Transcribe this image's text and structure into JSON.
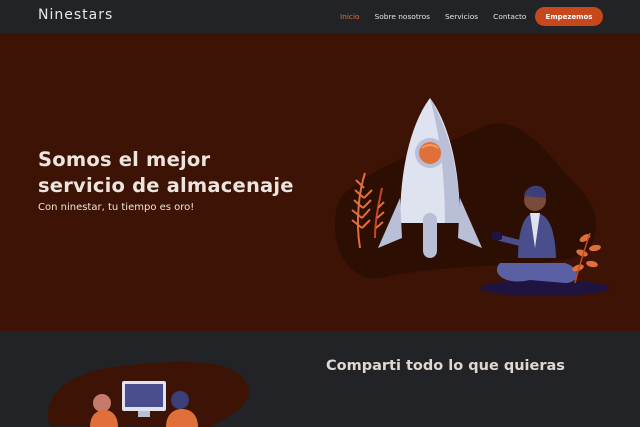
{
  "brand": "Ninestars",
  "nav": {
    "links": [
      "Inicio",
      "Sobre nosotros",
      "Servicios",
      "Contacto"
    ],
    "active_index": 0,
    "cta_label": "Empezemos"
  },
  "hero": {
    "title_line1": "Somos el mejor",
    "title_line2": "servicio de almacenaje",
    "subtitle": "Con ninestar, tu tiempo es oro!"
  },
  "section2": {
    "title": "Comparti todo lo que quieras"
  },
  "colors": {
    "accent": "#c8481c",
    "hero_bg": "#3c1304",
    "nav_bg": "#222326"
  },
  "icons": [
    "rocket-illustration",
    "person-with-phone-illustration",
    "people-at-computer-illustration"
  ]
}
